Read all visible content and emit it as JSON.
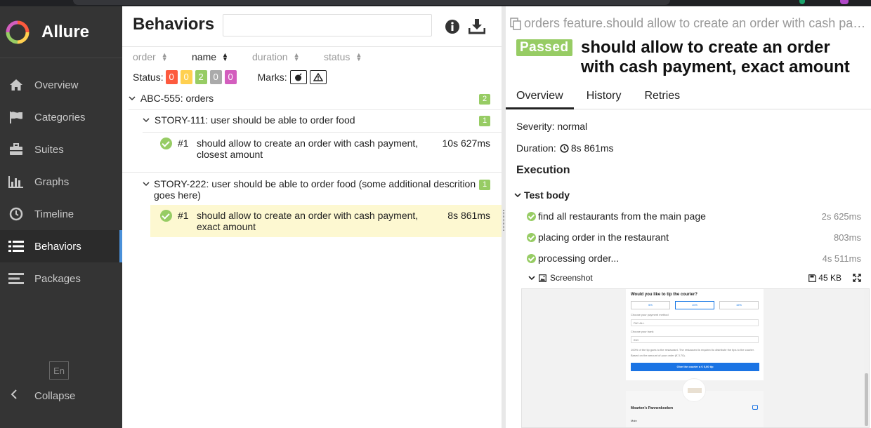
{
  "sidebar": {
    "app_name": "Allure",
    "items": [
      {
        "label": "Overview",
        "icon": "home-icon"
      },
      {
        "label": "Categories",
        "icon": "flag-icon"
      },
      {
        "label": "Suites",
        "icon": "briefcase-icon"
      },
      {
        "label": "Graphs",
        "icon": "bar-chart-icon"
      },
      {
        "label": "Timeline",
        "icon": "clock-icon"
      },
      {
        "label": "Behaviors",
        "icon": "list-icon",
        "active": true
      },
      {
        "label": "Packages",
        "icon": "align-left-icon"
      }
    ],
    "language": "En",
    "collapse_label": "Collapse"
  },
  "behaviors": {
    "title": "Behaviors",
    "search_value": "",
    "sorters": [
      "order",
      "name",
      "duration",
      "status"
    ],
    "active_sorter": "name",
    "status_label": "Status:",
    "status_counts": [
      {
        "value": "0",
        "color": "#fd5a3e"
      },
      {
        "value": "0",
        "color": "#ffd050"
      },
      {
        "value": "2",
        "color": "#97cc64"
      },
      {
        "value": "0",
        "color": "#aaaaaa"
      },
      {
        "value": "0",
        "color": "#d35ebe"
      }
    ],
    "marks_label": "Marks:",
    "tree": {
      "epic": {
        "label": "ABC-555: orders",
        "count": "2"
      },
      "stories": [
        {
          "label": "STORY-111: user should be able to order food",
          "count": "1",
          "cases": [
            {
              "num": "#1",
              "name": "should allow to create an order with cash payment, closest amount",
              "duration": "10s 627ms"
            }
          ]
        },
        {
          "label": "STORY-222: user should be able to order food (some additional descrition goes here)",
          "count": "1",
          "cases": [
            {
              "num": "#1",
              "name": "should allow to create an order with cash payment, exact amount",
              "duration": "8s 861ms",
              "selected": true
            }
          ]
        }
      ]
    }
  },
  "details": {
    "breadcrumb": "orders feature.should allow to create an order with cash payment, exact amount",
    "status": "Passed",
    "title": "should allow to create an order with cash payment, exact amount",
    "tabs": [
      "Overview",
      "History",
      "Retries"
    ],
    "severity": "Severity: normal",
    "duration_label": "Duration:",
    "duration_value": "8s 861ms",
    "execution_title": "Execution",
    "test_body_label": "Test body",
    "steps": [
      {
        "name": "find all restaurants from the main page",
        "duration": "2s 625ms"
      },
      {
        "name": "placing order in the restaurant",
        "duration": "803ms"
      },
      {
        "name": "processing order...",
        "duration": "4s 511ms"
      }
    ],
    "attachment": {
      "name": "Screenshot",
      "size": "45 KB"
    },
    "screenshot": {
      "question": "Would you like to tip the courier?",
      "tips": [
        "5%",
        "10%",
        "15%"
      ],
      "payment_label": "Choose your payment method",
      "payment_value": "PAY ALL",
      "bank_label": "Choose your bank",
      "bank_value": "ING",
      "note": "100% of the tip goes to the restaurant. The restaurant is required to distribute the tips to the courier.",
      "based_on": "Based on the amount of your order (€ 3.70).",
      "cta": "Give the courier a € 0,00 tip",
      "restaurant": "Moarten's Pannenkoeken",
      "menu": "Main"
    }
  }
}
